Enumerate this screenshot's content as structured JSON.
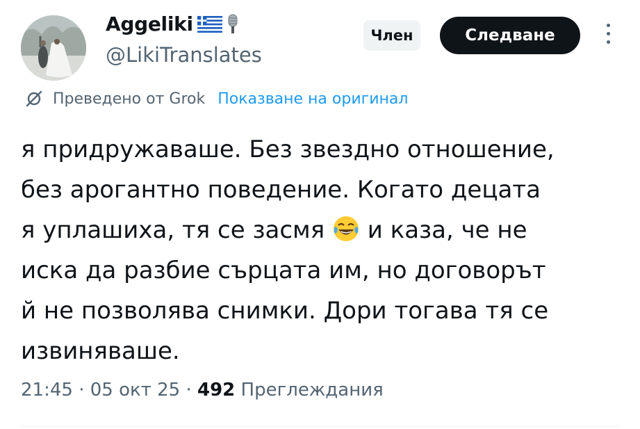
{
  "author": {
    "display_name": "Aggeliki",
    "handle": "@LikiTranslates",
    "flag": "greece-flag-icon",
    "badge_icon": "microphone-icon"
  },
  "actions": {
    "member_label": "Член",
    "follow_label": "Следване"
  },
  "translation": {
    "translated_by": "Преведено от Grok",
    "show_original": "Показване на оригинал"
  },
  "tweet": {
    "text_part1": "я придружаваше. Без звездно отношение,\nбез арогантно поведение. Когато децата\nя уплашиха, тя се засмя ",
    "emoji": "tears-of-joy-emoji",
    "text_part2": " и каза, че не\nиска да разбие сърцата им, но договорът\nй не позволява снимки. Дори тогава тя се\nизвиняваше."
  },
  "meta": {
    "time": "21:45",
    "date": "05 окт 25",
    "separator": "·",
    "views_count": "492",
    "views_label": "Преглеждания"
  },
  "colors": {
    "text": "#0f1419",
    "secondary": "#536471",
    "link": "#1d9bf0",
    "button_bg": "#0f1419"
  }
}
